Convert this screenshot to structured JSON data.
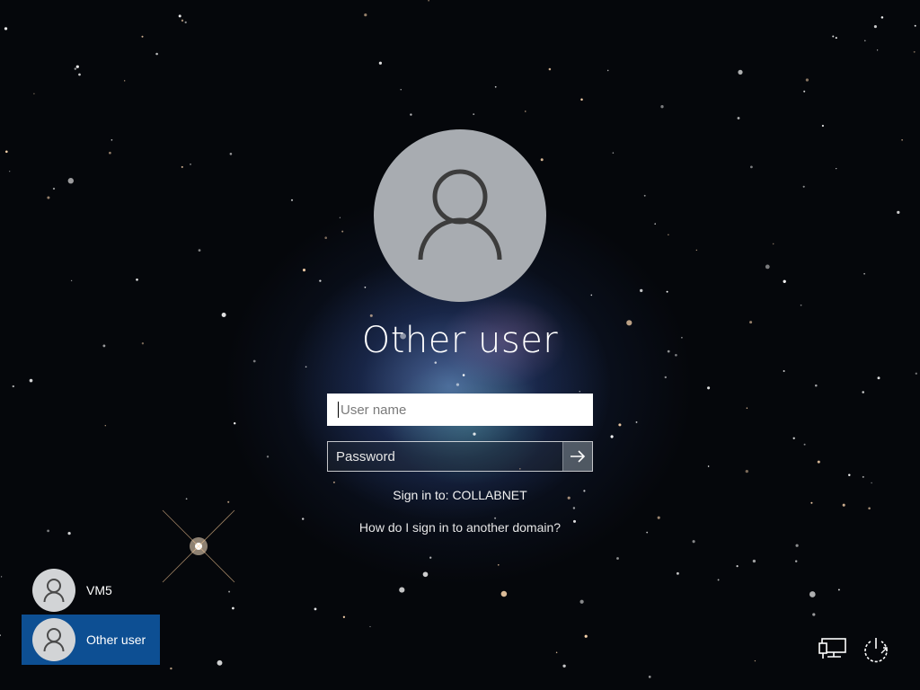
{
  "login": {
    "title": "Other user",
    "username_placeholder": "User name",
    "password_placeholder": "Password",
    "sign_in_to": "Sign in to: COLLABNET",
    "domain_help_link": "How do I sign in to another domain?"
  },
  "user_switcher": {
    "users": [
      {
        "label": "VM5",
        "selected": false
      },
      {
        "label": "Other user",
        "selected": true
      }
    ]
  },
  "system_tray": {
    "icons": [
      "network-icon",
      "power-icon"
    ]
  },
  "colors": {
    "selected_tile": "#0d4f93",
    "avatar_large_bg": "#a8acb1",
    "avatar_small_bg": "#d2d4d6"
  }
}
